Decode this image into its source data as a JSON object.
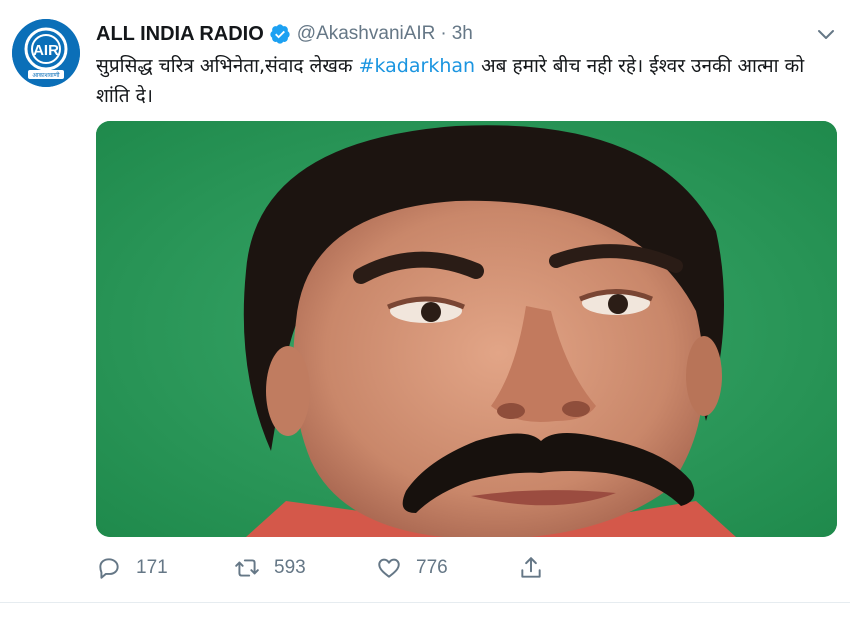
{
  "tweet": {
    "author_name": "ALL INDIA RADIO",
    "handle": "@AkashvaniAIR",
    "separator": "·",
    "time": "3h",
    "text_before": "सुप्रसिद्ध चरित्र अभिनेता,संवाद लेखक ",
    "hashtag": "#kadarkhan",
    "text_after": "  अब हमारे बीच नही रहे। ईश्वर उनकी आत्मा को शांति दे।",
    "logo_text": "AIR",
    "logo_subtext": "आकाशवाणी"
  },
  "actions": {
    "reply_count": "171",
    "retweet_count": "593",
    "like_count": "776"
  },
  "colors": {
    "link": "#1b95e0",
    "verified": "#1da1f2",
    "muted": "#657786",
    "photo_background": "#2f9a5c"
  }
}
